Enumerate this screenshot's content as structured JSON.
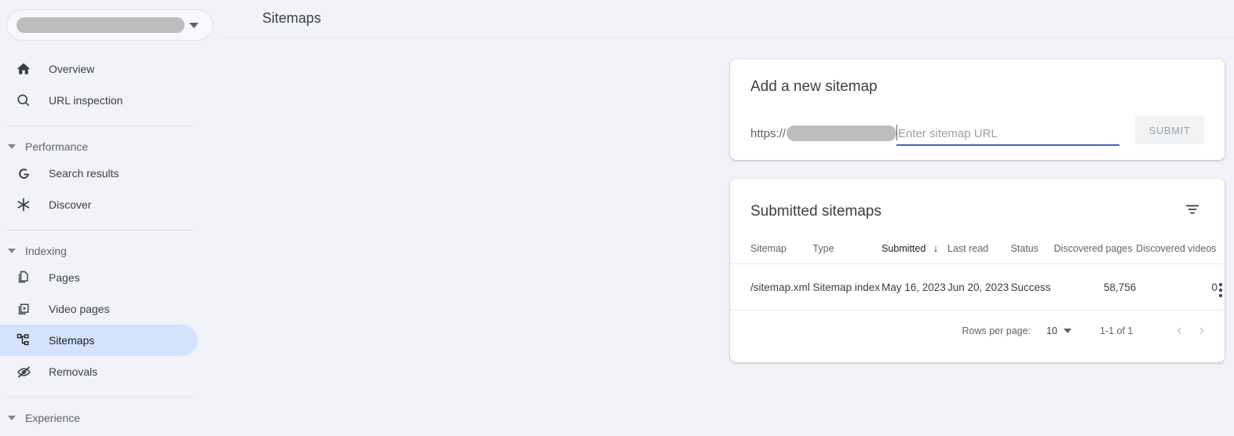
{
  "sidebar": {
    "property_selector": {
      "name": "property-selector",
      "value_redacted": true,
      "icon": "chevron-down-icon"
    },
    "nav_top": [
      {
        "label": "Overview",
        "icon": "home-icon",
        "active": false
      },
      {
        "label": "URL inspection",
        "icon": "search-icon",
        "active": false
      }
    ],
    "sections": [
      {
        "label": "Performance",
        "items": [
          {
            "label": "Search results",
            "icon": "google-g-icon",
            "active": false
          },
          {
            "label": "Discover",
            "icon": "asterisk-icon",
            "active": false
          }
        ]
      },
      {
        "label": "Indexing",
        "items": [
          {
            "label": "Pages",
            "icon": "pages-icon",
            "active": false
          },
          {
            "label": "Video pages",
            "icon": "video-icon",
            "active": false
          },
          {
            "label": "Sitemaps",
            "icon": "sitemap-icon",
            "active": true
          },
          {
            "label": "Removals",
            "icon": "eye-off-icon",
            "active": false
          }
        ]
      },
      {
        "label": "Experience",
        "items": []
      }
    ]
  },
  "header": {
    "title": "Sitemaps"
  },
  "add_sitemap": {
    "title": "Add a new sitemap",
    "url_prefix": "https://",
    "domain_redacted": true,
    "input_value": "",
    "input_placeholder": "Enter sitemap URL",
    "submit_label": "SUBMIT",
    "submit_disabled": true,
    "underline_color": "#3b69b0"
  },
  "submitted_sitemaps": {
    "title": "Submitted sitemaps",
    "filter_icon": "filter-icon",
    "columns": [
      {
        "key": "sitemap",
        "label": "Sitemap",
        "sorted": false
      },
      {
        "key": "type",
        "label": "Type",
        "sorted": false
      },
      {
        "key": "submitted",
        "label": "Submitted",
        "sorted": true,
        "sort_dir": "desc",
        "sort_glyph": "↓"
      },
      {
        "key": "last_read",
        "label": "Last read",
        "sorted": false
      },
      {
        "key": "status",
        "label": "Status",
        "sorted": false
      },
      {
        "key": "discovered_pages",
        "label": "Discovered pages",
        "sorted": false
      },
      {
        "key": "discovered_videos",
        "label": "Discovered videos",
        "sorted": false
      }
    ],
    "rows": [
      {
        "sitemap": "/sitemap.xml",
        "type": "Sitemap index",
        "submitted": "May 16, 2023",
        "last_read": "Jun 20, 2023",
        "status": "Success",
        "status_color": "#1e8e3e",
        "discovered_pages": "58,756",
        "discovered_videos": "0",
        "menu_icon": "kebab-menu-icon"
      }
    ],
    "pagination": {
      "rows_per_page_label": "Rows per page:",
      "rows_per_page_value": "10",
      "range_label": "1-1 of 1",
      "prev_glyph": "‹",
      "next_glyph": "›"
    }
  },
  "colors": {
    "page_background": "#f1f3f9",
    "card_background": "#ffffff",
    "active_nav_background": "#d3e3fd",
    "success_green": "#1e8e3e",
    "accent_blue": "#3b69b0"
  }
}
